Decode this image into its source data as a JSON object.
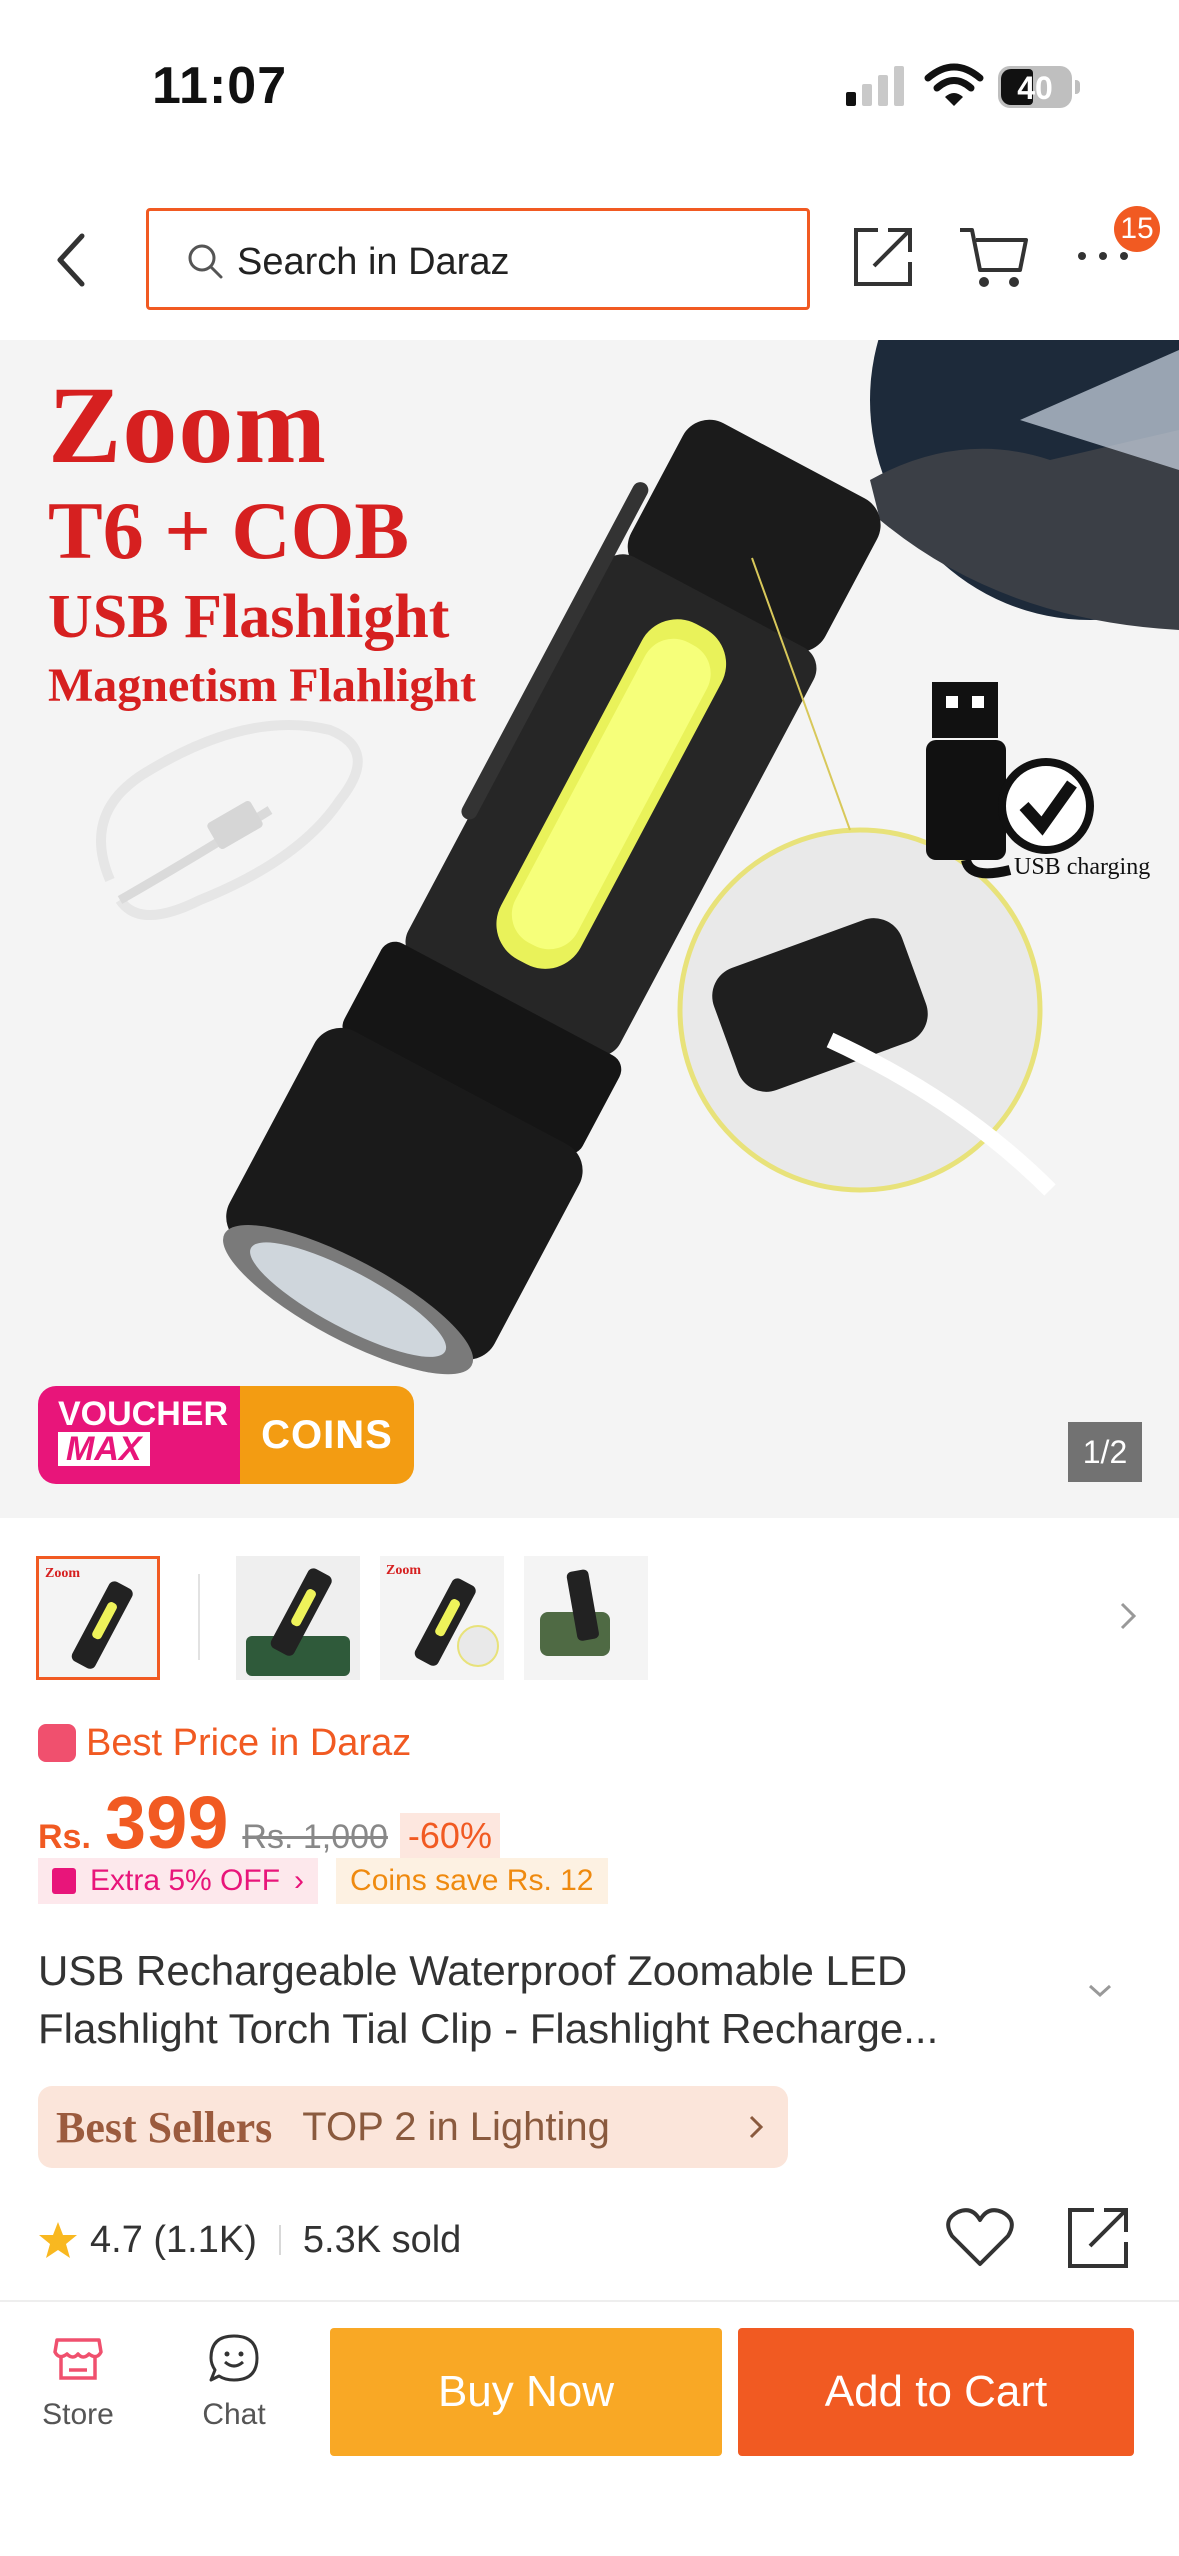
{
  "status_bar": {
    "time": "11:07",
    "battery": "40",
    "icons": [
      "signal-icon",
      "wifi-icon",
      "battery-icon"
    ]
  },
  "header": {
    "search_placeholder": "Search in Daraz",
    "cart_badge": "15",
    "icons": [
      "back-arrow-icon",
      "search-icon",
      "share-icon",
      "cart-icon",
      "more-icon"
    ]
  },
  "gallery": {
    "promo_lines": [
      "Zoom",
      "T6 + COB",
      "USB Flashlight",
      "Magnetism Flahlight"
    ],
    "usb_label": "USB charging",
    "voucher_top": "VOUCHER",
    "voucher_max": "MAX",
    "coins": "COINS",
    "counter": "1/2"
  },
  "product": {
    "best_price": "Best Price in Daraz",
    "currency": "Rs.",
    "price": "399",
    "original_price": "Rs. 1,000",
    "discount": "-60%",
    "extra_off": "Extra 5% OFF",
    "coins_save": "Coins save Rs. 12",
    "title_line1": "USB Rechargeable Waterproof Zoomable LED",
    "title_line2": "Flashlight Torch Tial Clip - Flashlight Recharge...",
    "best_sellers": "Best Sellers",
    "ranking": "TOP 2 in Lighting",
    "rating": "4.7 (1.1K)",
    "sold": "5.3K sold"
  },
  "bottom_bar": {
    "store": "Store",
    "chat": "Chat",
    "buy_now": "Buy Now",
    "add_to_cart": "Add to Cart"
  },
  "colors": {
    "accent": "#f15a22",
    "buy_now": "#f9a825",
    "voucher_pink": "#e8157a",
    "promo_red": "#d62020"
  }
}
